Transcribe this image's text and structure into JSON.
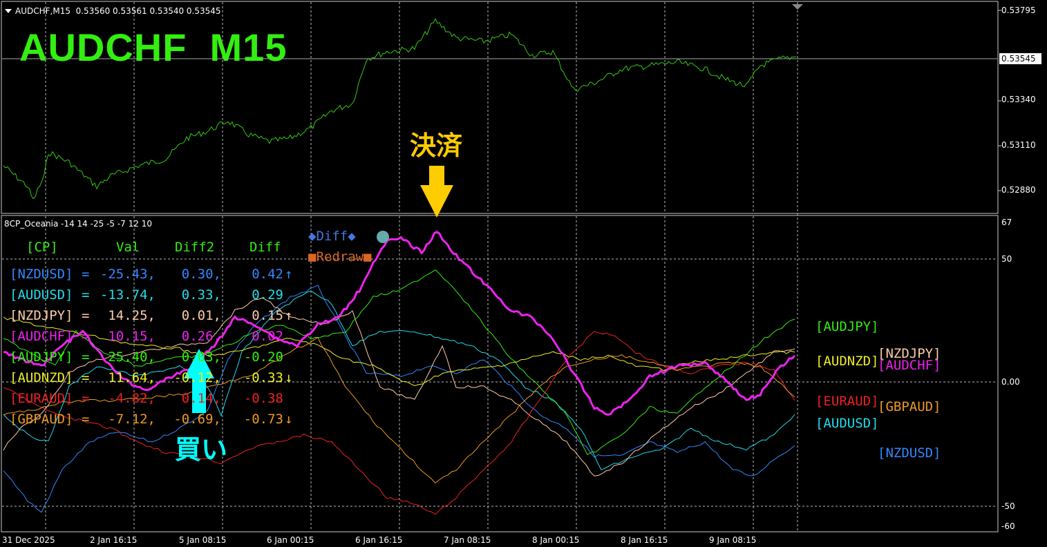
{
  "main_chart": {
    "header": "AUDCHF,M15  0.53560 0.53561 0.53540 0.53545",
    "title": "AUDCHF  M15",
    "current_price": "0.53545",
    "y_axis": [
      "0.53795",
      "0.53340",
      "0.53110",
      "0.52880"
    ],
    "line_color": "#33cc11"
  },
  "indicator": {
    "header": "8CP_Oceania -14 14 -25 -5 -7 12 10",
    "y_axis": [
      "67",
      "50",
      "0.00",
      "-50",
      "-60"
    ],
    "legend": {
      "diff": "◆Diff◆",
      "redraw": "■Redraw■",
      "diff_color": "#4477dd",
      "redraw_color": "#dd6622",
      "dot_color": "#66aaaa"
    },
    "table_header": {
      "cp": "[CP]",
      "val": "Val",
      "diff2": "Diff2",
      "diff": "Diff"
    },
    "rows": [
      {
        "pair": "[NZDUSD]",
        "eq": "=",
        "val": "-25.43,",
        "diff2": "0.30,",
        "diff": "0.42",
        "arrow": "↑",
        "color": "#3388ff"
      },
      {
        "pair": "[AUDUSD]",
        "eq": "=",
        "val": "-13.74,",
        "diff2": "0.33,",
        "diff": "0.29",
        "arrow": "",
        "color": "#22ddee"
      },
      {
        "pair": "[NZDJPY]",
        "eq": "=",
        "val": "14.25,",
        "diff2": "0.01,",
        "diff": "0.15",
        "arrow": "↑",
        "color": "#ffccaa"
      },
      {
        "pair": "[AUDCHF]",
        "eq": "=",
        "val": "10.15,",
        "diff2": "0.26,",
        "diff": "0.02",
        "arrow": "",
        "color": "#ee22ee"
      },
      {
        "pair": "[AUDJPY]",
        "eq": "=",
        "val": "25.40,",
        "diff2": "0.03,",
        "diff": "-0.20",
        "arrow": "",
        "color": "#33ee11"
      },
      {
        "pair": "[AUDNZD]",
        "eq": "=",
        "val": "11.64,",
        "diff2": "-0.12,",
        "diff": "-0.33",
        "arrow": "↓",
        "color": "#eeee22"
      },
      {
        "pair": "[EURAUD]",
        "eq": "=",
        "val": "-4.82,",
        "diff2": "0.14,",
        "diff": "-0.38",
        "arrow": "",
        "color": "#ee2222"
      },
      {
        "pair": "[GBPAUD]",
        "eq": "=",
        "val": "-7.12,",
        "diff2": "-0.69,",
        "diff": "-0.73",
        "arrow": "↓",
        "color": "#ee9922"
      }
    ],
    "side_labels": [
      {
        "text": "[AUDJPY]",
        "color": "#33ee11"
      },
      {
        "text": "[NZDJPY]",
        "color": "#ffccaa"
      },
      {
        "text": "[AUDNZD]",
        "color": "#eeee22"
      },
      {
        "text": "[AUDCHF]",
        "color": "#ee22ee"
      },
      {
        "text": "[EURAUD]",
        "color": "#ee2222"
      },
      {
        "text": "[GBPAUD]",
        "color": "#ee9922"
      },
      {
        "text": "[AUDUSD]",
        "color": "#22ddee"
      },
      {
        "text": "[NZDUSD]",
        "color": "#3388ff"
      }
    ]
  },
  "x_axis": [
    "31 Dec 2025",
    "2 Jan 16:15",
    "5 Jan 08:15",
    "6 Jan 00:15",
    "6 Jan 16:15",
    "7 Jan 08:15",
    "8 Jan 00:15",
    "8 Jan 16:15",
    "9 Jan 08:15"
  ],
  "annotations": {
    "settle_label": "決済",
    "settle_color": "#ffcc00",
    "buy_label": "買い",
    "buy_color": "#00ffff"
  }
}
